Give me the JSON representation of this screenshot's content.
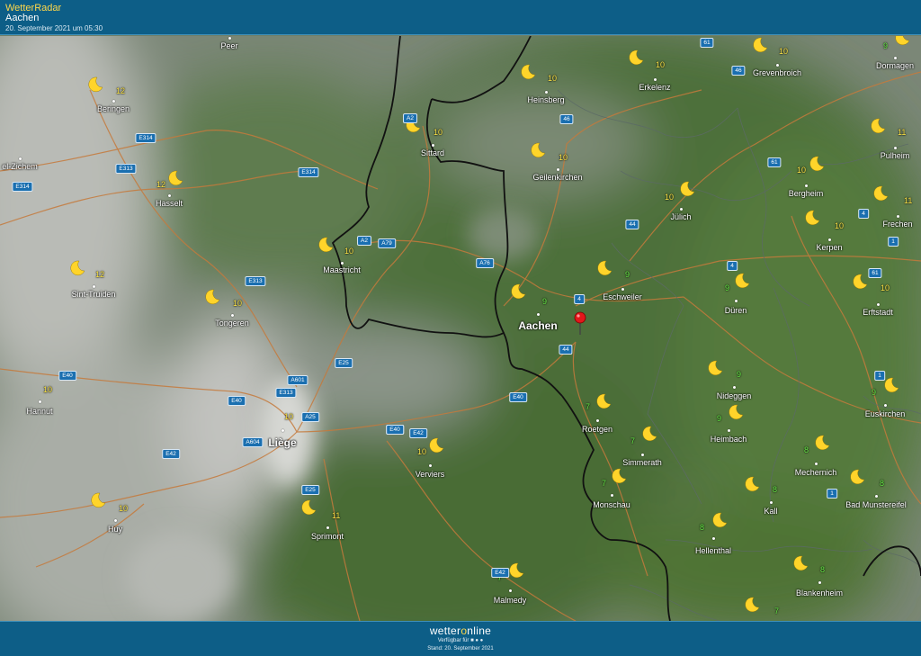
{
  "header": {
    "app_title": "WetterRadar",
    "location": "Aachen",
    "timestamp": "20. September 2021 um 05:30"
  },
  "footer": {
    "brand_a": "wetter",
    "brand_o": "o",
    "brand_b": "nline",
    "available": "Verfügbar für",
    "stand": "Stand: 20. September 2021"
  },
  "cities": [
    {
      "id": "peer",
      "name": "Peer"
    },
    {
      "id": "beringen",
      "name": "Beringen",
      "temp": "12",
      "tc": "y"
    },
    {
      "id": "zichem",
      "name": "el-Zichem"
    },
    {
      "id": "hasselt",
      "name": "Hasselt",
      "temp": "12",
      "tc": "y"
    },
    {
      "id": "sint-truiden",
      "name": "Sint-Truiden",
      "temp": "12",
      "tc": "y"
    },
    {
      "id": "tongeren",
      "name": "Tongeren",
      "temp": "10",
      "tc": "y"
    },
    {
      "id": "maastricht",
      "name": "Maastricht",
      "temp": "10",
      "tc": "y"
    },
    {
      "id": "sittard",
      "name": "Sittard",
      "temp": "10",
      "tc": "y"
    },
    {
      "id": "heinsberg",
      "name": "Heinsberg",
      "temp": "10",
      "tc": "y"
    },
    {
      "id": "erkelenz",
      "name": "Erkelenz",
      "temp": "10",
      "tc": "y"
    },
    {
      "id": "grevenbroich",
      "name": "Grevenbroich",
      "temp": "10",
      "tc": "y"
    },
    {
      "id": "dormagen",
      "name": "Dormagen",
      "temp": "9",
      "tc": "g"
    },
    {
      "id": "geilenkirchen",
      "name": "Geilenkirchen",
      "temp": "10",
      "tc": "y"
    },
    {
      "id": "julich",
      "name": "Jülich",
      "temp": "10",
      "tc": "y"
    },
    {
      "id": "bergheim",
      "name": "Bergheim",
      "temp": "10",
      "tc": "y"
    },
    {
      "id": "pulheim",
      "name": "Pulheim",
      "temp": "11",
      "tc": "y"
    },
    {
      "id": "frechen",
      "name": "Frechen",
      "temp": "11",
      "tc": "y"
    },
    {
      "id": "kerpen",
      "name": "Kerpen",
      "temp": "10",
      "tc": "y"
    },
    {
      "id": "aachen",
      "name": "Aachen",
      "temp": "9",
      "tc": "g"
    },
    {
      "id": "eschweiler",
      "name": "Eschweiler",
      "temp": "9",
      "tc": "g"
    },
    {
      "id": "duren",
      "name": "Düren",
      "temp": "9",
      "tc": "g"
    },
    {
      "id": "erftstadt",
      "name": "Erftstadt",
      "temp": "10",
      "tc": "y"
    },
    {
      "id": "hannut",
      "name": "Hannut",
      "temp": "10",
      "tc": "y"
    },
    {
      "id": "liege",
      "name": "Liège",
      "temp": "10",
      "tc": "y"
    },
    {
      "id": "verviers",
      "name": "Verviers",
      "temp": "10",
      "tc": "y"
    },
    {
      "id": "roetgen",
      "name": "Roetgen",
      "temp": "7",
      "tc": "g"
    },
    {
      "id": "nideggen",
      "name": "Nideggen",
      "temp": "9",
      "tc": "g"
    },
    {
      "id": "euskirchen",
      "name": "Euskirchen",
      "temp": "9",
      "tc": "g"
    },
    {
      "id": "heimbach",
      "name": "Heimbach",
      "temp": "9",
      "tc": "g"
    },
    {
      "id": "simmerath",
      "name": "Simmerath",
      "temp": "7",
      "tc": "g"
    },
    {
      "id": "mechernich",
      "name": "Mechernich",
      "temp": "8",
      "tc": "g"
    },
    {
      "id": "monschau",
      "name": "Monschau",
      "temp": "7",
      "tc": "g"
    },
    {
      "id": "kall",
      "name": "Kall",
      "temp": "8",
      "tc": "g"
    },
    {
      "id": "bad-munstereifel",
      "name": "Bad Munstereifel",
      "temp": "8",
      "tc": "g"
    },
    {
      "id": "huy",
      "name": "Huy",
      "temp": "10",
      "tc": "y"
    },
    {
      "id": "sprimont",
      "name": "Sprimont",
      "temp": "11",
      "tc": "y"
    },
    {
      "id": "hellenthal",
      "name": "Hellenthal",
      "temp": "8",
      "tc": "g"
    },
    {
      "id": "malmedy",
      "name": "Malmedy",
      "temp": "7",
      "tc": "g"
    },
    {
      "id": "blankenheim",
      "name": "Blankenheim",
      "temp": "8",
      "tc": "g"
    },
    {
      "id": "corner",
      "name": "",
      "temp": "7",
      "tc": "g"
    }
  ],
  "roads": [
    "61",
    "46",
    "46",
    "A2",
    "E314",
    "E313",
    "E314",
    "E314",
    "A2",
    "A79",
    "A76",
    "E313",
    "4",
    "44",
    "61",
    "4",
    "4",
    "1",
    "61",
    "1",
    "E40",
    "A601",
    "E25",
    "E313",
    "E40",
    "A25",
    "E40",
    "E42",
    "E42",
    "E40",
    "44",
    "A604",
    "E25",
    "E42",
    "E42",
    "1"
  ]
}
